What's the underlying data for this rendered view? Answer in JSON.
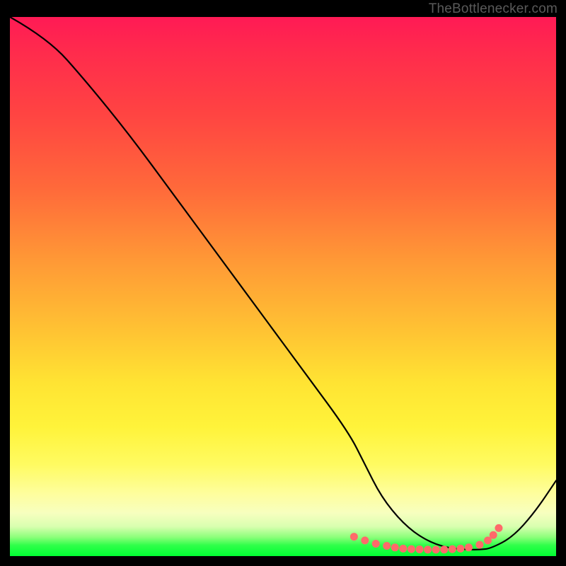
{
  "watermark": "TheBottlenecker.com",
  "chart_data": {
    "type": "line",
    "title": "",
    "xlabel": "",
    "ylabel": "",
    "xlim": [
      0,
      100
    ],
    "ylim": [
      0,
      100
    ],
    "grid": false,
    "series": [
      {
        "name": "curve",
        "color": "#000000",
        "x": [
          0,
          7,
          14,
          22,
          30,
          38,
          46,
          54,
          62,
          65,
          68,
          72,
          76,
          80,
          84,
          86,
          88,
          92,
          96,
          100
        ],
        "y": [
          100,
          96,
          88,
          78,
          67,
          56,
          45,
          34,
          23,
          17,
          11,
          6,
          3,
          1.5,
          1.2,
          1.2,
          1.4,
          3.5,
          8,
          14
        ]
      }
    ],
    "markers": {
      "name": "highlight-dots",
      "color": "#ff6a6a",
      "radius_px": 5.5,
      "x": [
        63,
        65,
        67,
        69,
        70.5,
        72,
        73.5,
        75,
        76.5,
        78,
        79.5,
        81,
        82.5,
        84,
        86,
        87.5,
        88.5,
        89.5
      ],
      "y": [
        3.6,
        2.9,
        2.3,
        1.9,
        1.6,
        1.4,
        1.3,
        1.25,
        1.2,
        1.2,
        1.22,
        1.3,
        1.4,
        1.6,
        2.1,
        2.9,
        3.9,
        5.2
      ]
    }
  }
}
